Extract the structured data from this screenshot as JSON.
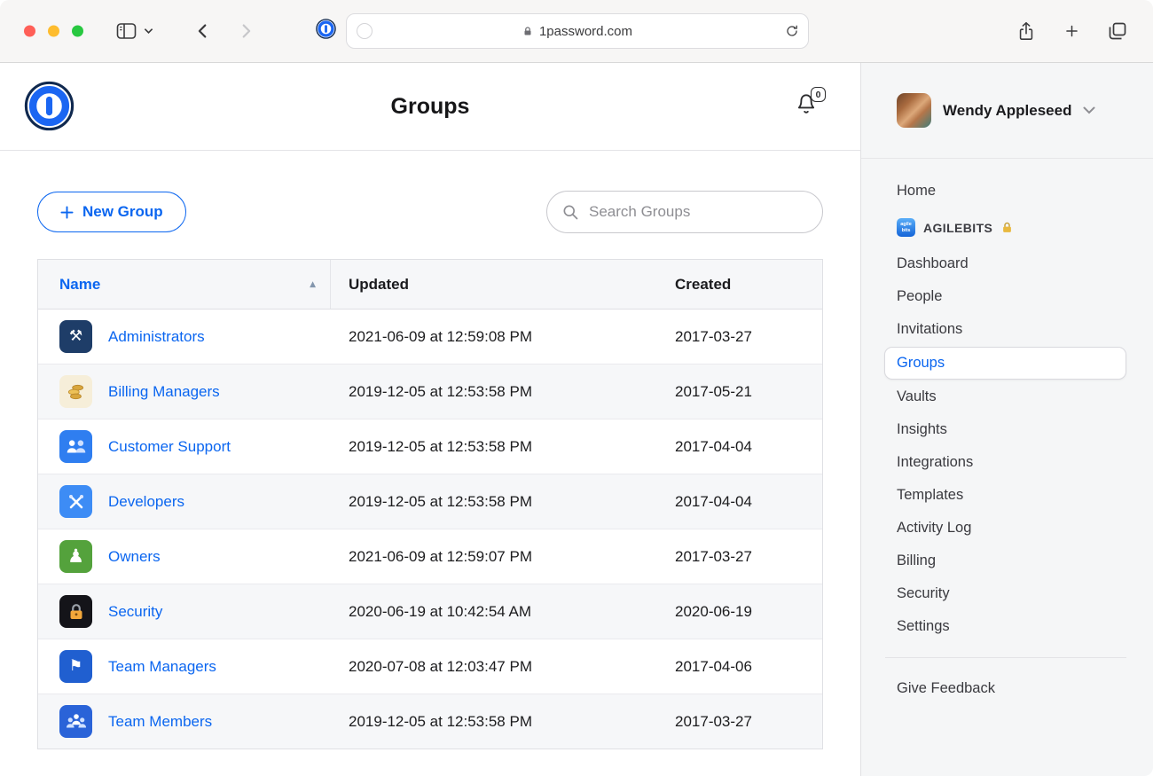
{
  "browser": {
    "url": "1password.com"
  },
  "page": {
    "title": "Groups",
    "notification_badge": "0"
  },
  "actions": {
    "new_group_label": "New Group",
    "search_placeholder": "Search Groups"
  },
  "table": {
    "headers": {
      "name": "Name",
      "updated": "Updated",
      "created": "Created"
    },
    "sort": {
      "column": "Name",
      "direction": "ascending",
      "arrow": "▲"
    },
    "rows": [
      {
        "name": "Administrators",
        "updated": "2021-06-09 at 12:59:08 PM",
        "created": "2017-03-27",
        "icon": "crossed-tools-icon",
        "icon_bg": "#1e3d68",
        "glyph": "⚒"
      },
      {
        "name": "Billing Managers",
        "updated": "2019-12-05 at 12:53:58 PM",
        "created": "2017-05-21",
        "icon": "coins-icon",
        "icon_bg": "#f6eed9",
        "glyph": ""
      },
      {
        "name": "Customer Support",
        "updated": "2019-12-05 at 12:53:58 PM",
        "created": "2017-04-04",
        "icon": "people-icon",
        "icon_bg": "#2f7ef0",
        "glyph": ""
      },
      {
        "name": "Developers",
        "updated": "2019-12-05 at 12:53:58 PM",
        "created": "2017-04-04",
        "icon": "wrench-hammer-icon",
        "icon_bg": "#3d8cf5",
        "glyph": ""
      },
      {
        "name": "Owners",
        "updated": "2021-06-09 at 12:59:07 PM",
        "created": "2017-03-27",
        "icon": "chess-piece-icon",
        "icon_bg": "#54a23c",
        "glyph": "♟"
      },
      {
        "name": "Security",
        "updated": "2020-06-19 at 10:42:54 AM",
        "created": "2020-06-19",
        "icon": "padlock-icon",
        "icon_bg": "#141419",
        "glyph": ""
      },
      {
        "name": "Team Managers",
        "updated": "2020-07-08 at 12:03:47 PM",
        "created": "2017-04-06",
        "icon": "flag-icon",
        "icon_bg": "#205fd0",
        "glyph": "⚑"
      },
      {
        "name": "Team Members",
        "updated": "2019-12-05 at 12:53:58 PM",
        "created": "2017-03-27",
        "icon": "people-group-icon",
        "icon_bg": "#2a63d8",
        "glyph": ""
      }
    ]
  },
  "sidebar": {
    "user_name": "Wendy Appleseed",
    "org_label": "AGILEBITS",
    "org_icon_lines": [
      "agile",
      "bits"
    ],
    "items": [
      "Home",
      "Dashboard",
      "People",
      "Invitations",
      "Groups",
      "Vaults",
      "Insights",
      "Integrations",
      "Templates",
      "Activity Log",
      "Billing",
      "Security",
      "Settings"
    ],
    "footer_label": "Give Feedback"
  },
  "colors": {
    "accent": "#0b66f0",
    "sidebar_bg": "#f5f6f7",
    "traffic_red": "#ff5f57",
    "traffic_yellow": "#febc2e",
    "traffic_green": "#28c840"
  }
}
